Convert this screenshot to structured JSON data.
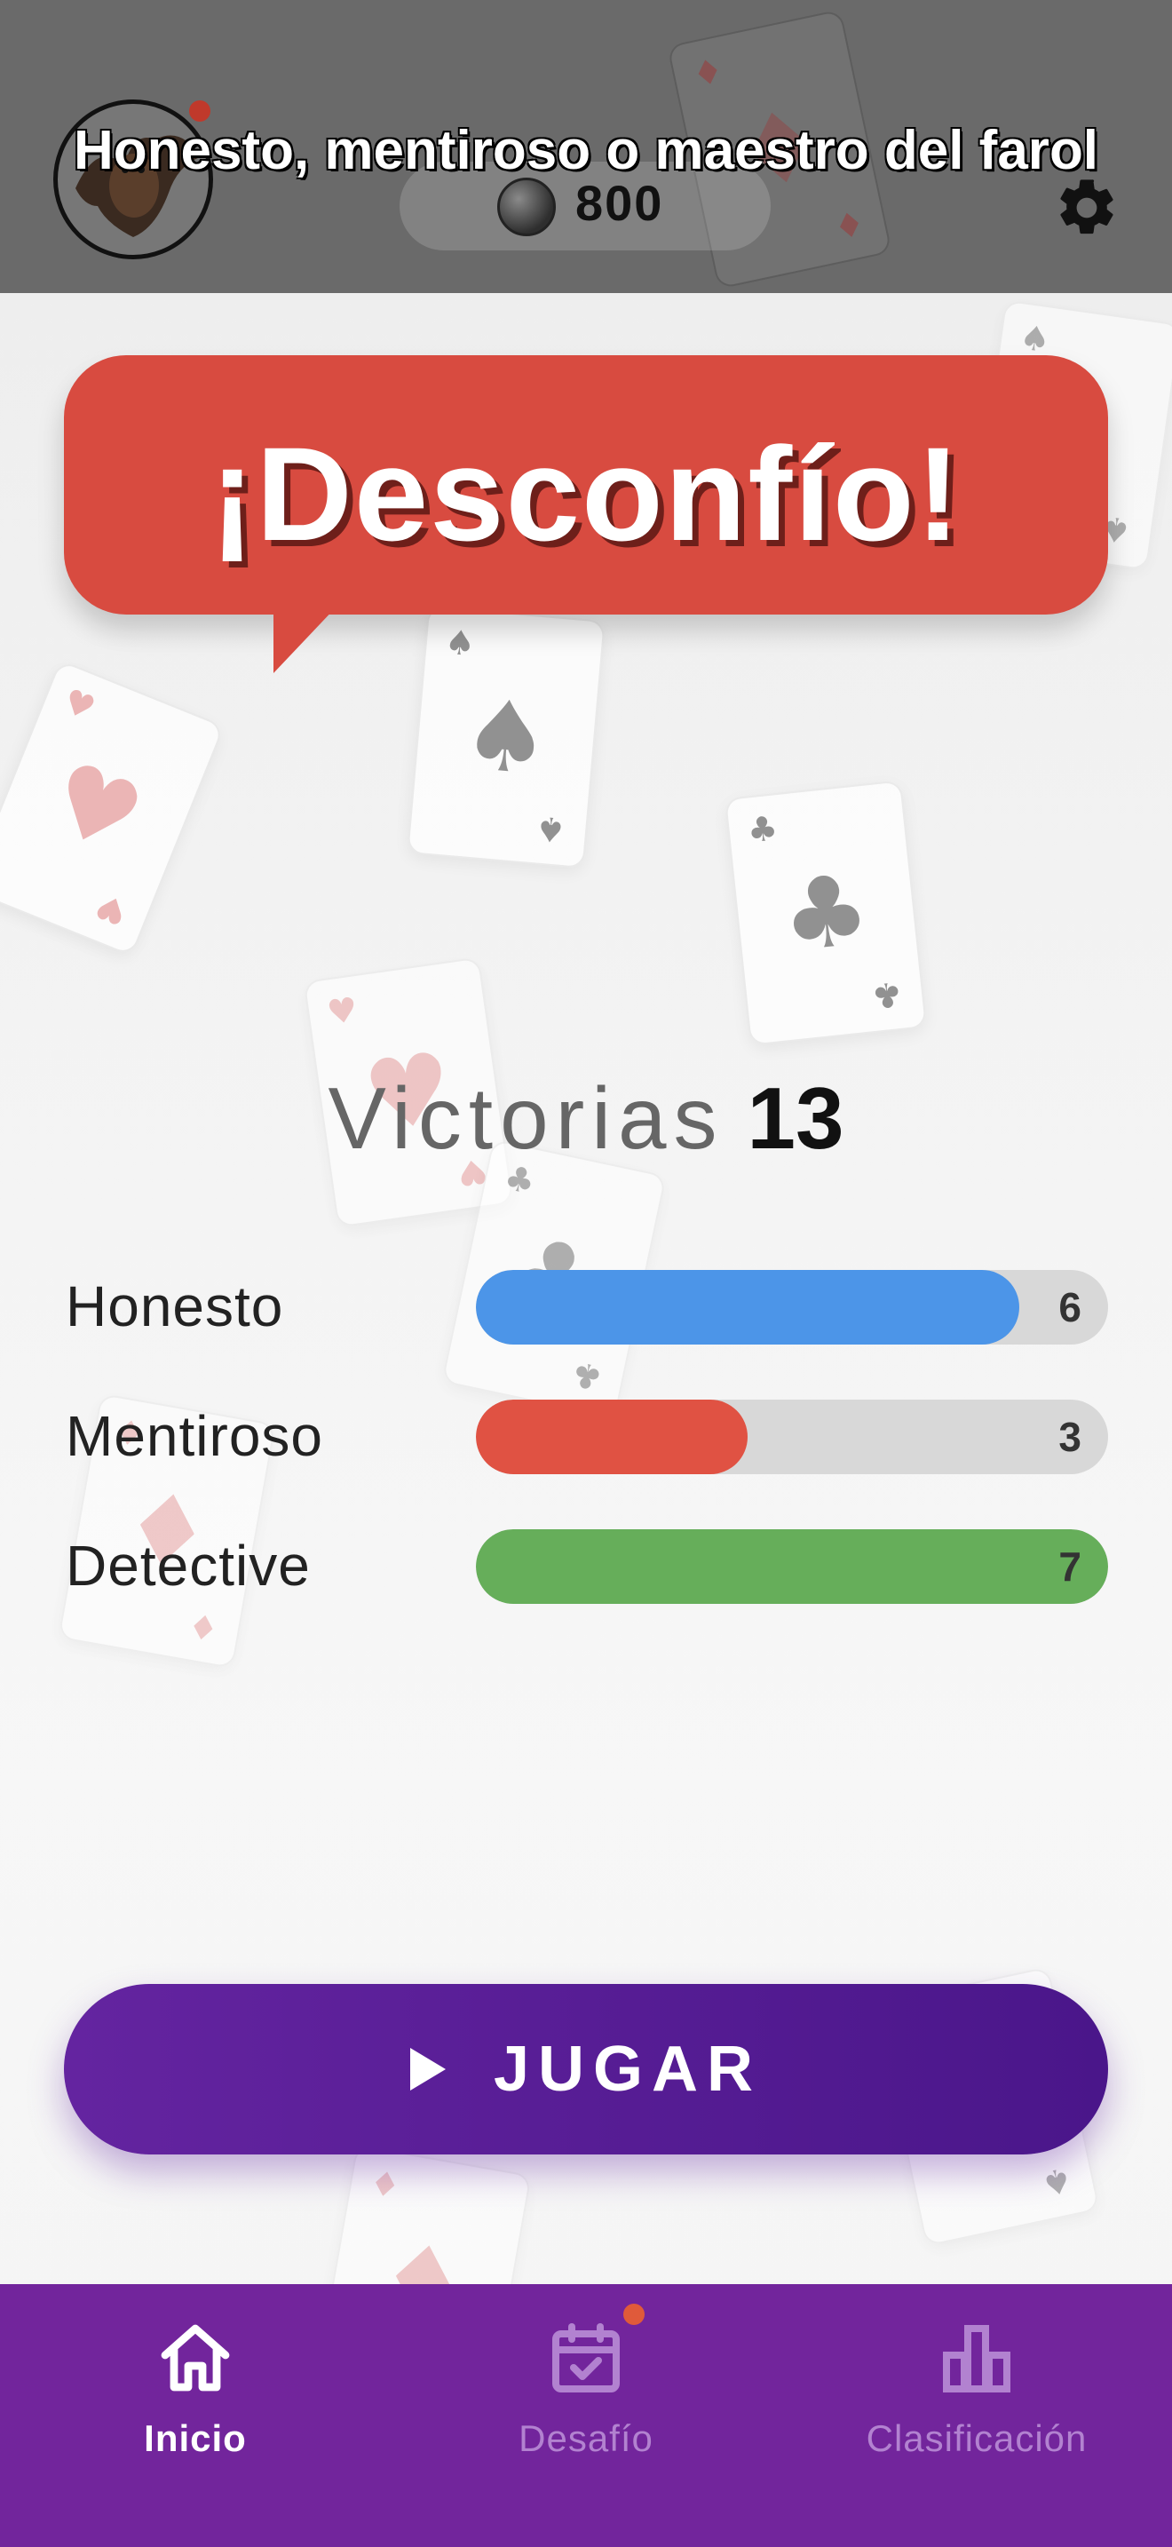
{
  "header": {
    "title": "Honesto, mentiroso o maestro del farol",
    "coins": "800",
    "coin_icon": "coin-icon",
    "settings_icon": "gear-icon",
    "avatar_icon": "bat-avatar"
  },
  "banner": {
    "text": "¡Desconfío!",
    "color": "#d84b40"
  },
  "victories": {
    "label": "Victorias",
    "value": "13"
  },
  "stats": [
    {
      "label": "Honesto",
      "value": "6",
      "fill_percent": 86,
      "color": "#4c95e8"
    },
    {
      "label": "Mentiroso",
      "value": "3",
      "fill_percent": 43,
      "color": "#e05243"
    },
    {
      "label": "Detective",
      "value": "7",
      "fill_percent": 100,
      "color": "#66ae5a"
    }
  ],
  "play_button": {
    "label": "JUGAR",
    "icon": "play-icon"
  },
  "nav": {
    "items": [
      {
        "label": "Inicio",
        "icon": "home-icon",
        "active": true
      },
      {
        "label": "Desafío",
        "icon": "calendar-check-icon",
        "active": false,
        "badge": true
      },
      {
        "label": "Clasificación",
        "icon": "bar-chart-icon",
        "active": false
      }
    ],
    "accent": "#72259c"
  }
}
